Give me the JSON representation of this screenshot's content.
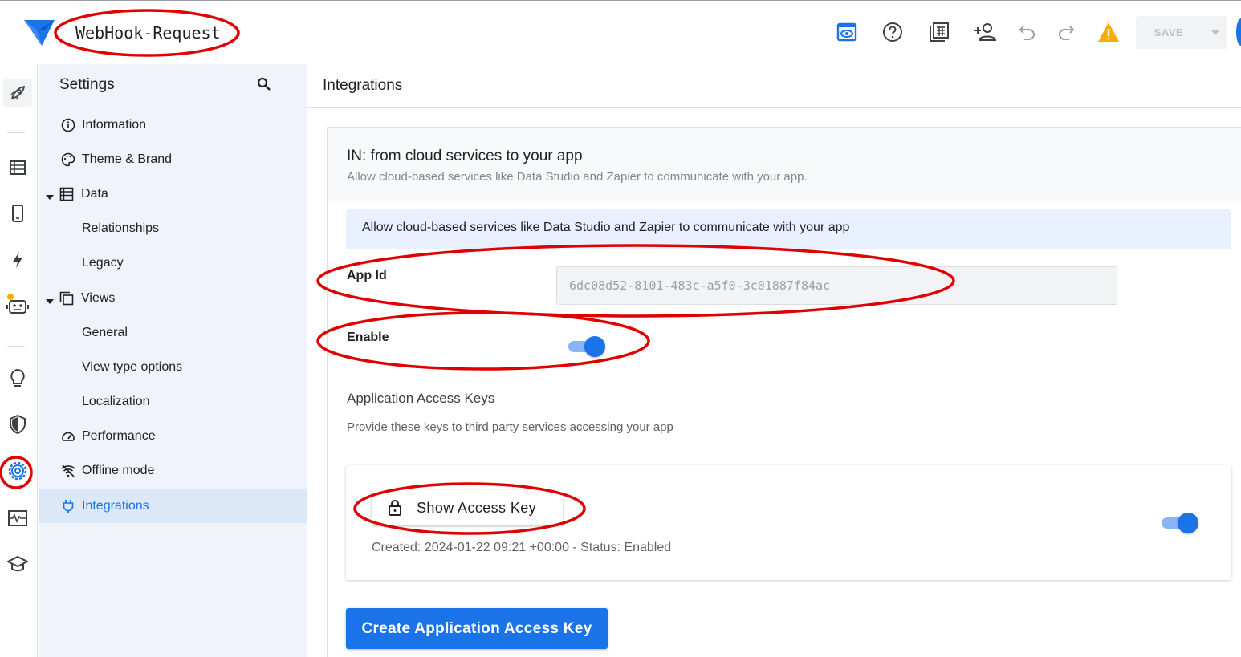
{
  "header": {
    "app_name": "WebHook-Request",
    "save_label": "SAVE",
    "icons": [
      "preview-icon",
      "help-icon",
      "gallery-icon",
      "share-user-icon",
      "undo-icon",
      "redo-icon",
      "warning-icon"
    ],
    "warning_color": "#f9ab00"
  },
  "rail": {
    "items": [
      "launch-icon",
      "data-icon",
      "views-icon",
      "automation-icon",
      "bot-icon",
      "intelligence-icon",
      "security-icon",
      "settings-icon",
      "monitor-icon",
      "learn-icon"
    ],
    "active": "settings-icon"
  },
  "nav": {
    "title": "Settings",
    "items": [
      {
        "label": "Information",
        "icon": "info-icon"
      },
      {
        "label": "Theme & Brand",
        "icon": "palette-icon"
      },
      {
        "label": "Data",
        "icon": "table-icon",
        "expanded": true
      },
      {
        "label": "Relationships"
      },
      {
        "label": "Legacy"
      },
      {
        "label": "Views",
        "icon": "views-copy-icon",
        "expanded": true
      },
      {
        "label": "General"
      },
      {
        "label": "View type options"
      },
      {
        "label": "Localization"
      },
      {
        "label": "Performance",
        "icon": "speed-icon"
      },
      {
        "label": "Offline mode",
        "icon": "wifi-off-icon"
      },
      {
        "label": "Integrations",
        "icon": "plug-icon",
        "active": true
      }
    ]
  },
  "main": {
    "title": "Integrations",
    "card_title": "IN: from cloud services to your app",
    "card_subtitle": "Allow cloud-based services like Data Studio and Zapier to communicate with your app.",
    "banner": "Allow cloud-based services like Data Studio and Zapier to communicate with your app",
    "app_id_label": "App Id",
    "app_id_value": "6dc08d52-8101-483c-a5f0-3c01887f84ac",
    "enable_label": "Enable",
    "enable_on": true,
    "keys_title": "Application Access Keys",
    "keys_subtitle": "Provide these keys to third party services accessing your app",
    "show_key_label": "Show Access Key",
    "key_meta": "Created: 2024-01-22 09:21 +00:00 - Status: Enabled",
    "key_enabled": true,
    "create_button": "Create Application Access Key"
  },
  "colors": {
    "accent": "#1a73e8",
    "nav_bg": "#f0f4fa",
    "nav_active_bg": "#dbe8f7",
    "annotation": "#e00000"
  }
}
